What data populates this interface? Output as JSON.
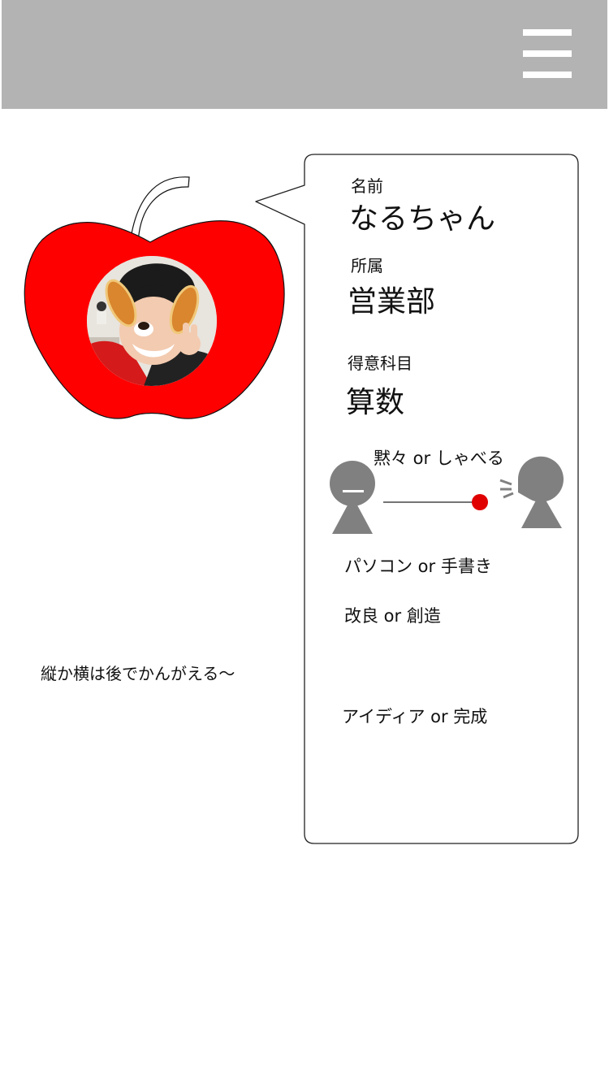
{
  "header": {
    "background": "#b3b3b3",
    "menu_icon": "hamburger-menu-icon"
  },
  "avatar": {
    "frame_icon": "apple-frame",
    "frame_color": "#ff0000",
    "photo": "profile-photo"
  },
  "profile": {
    "name_label": "名前",
    "name_value": "なるちゃん",
    "department_label": "所属",
    "department_value": "営業部",
    "subject_label": "得意科目",
    "subject_value": "算数",
    "talk_scale_label": "黙々 or しゃべる",
    "talk_scale_level": 0.85,
    "talk_scale_marker_color": "#e00000",
    "option_pc": "パソコン or 手書き",
    "option_improve": "改良 or 創造",
    "option_idea": "アイディア or 完成"
  },
  "note": "縦か横は後でかんがえる〜"
}
